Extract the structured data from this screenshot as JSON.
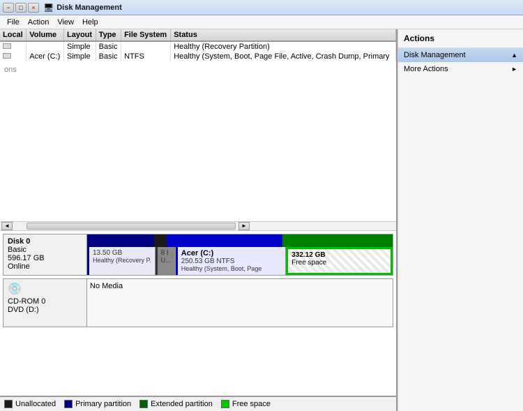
{
  "titleBar": {
    "title": "Disk Management",
    "closeLabel": "×",
    "minimizeLabel": "−",
    "maxrestoreLabel": "□"
  },
  "menuBar": {
    "items": [
      "File",
      "Action",
      "View",
      "Help"
    ]
  },
  "table": {
    "columns": [
      "Local",
      "Volume",
      "Layout",
      "Type",
      "File System",
      "Status"
    ],
    "rows": [
      {
        "local": "",
        "volume": "",
        "layout": "Simple",
        "type": "Basic",
        "fileSystem": "",
        "status": "Healthy (Recovery Partition)"
      },
      {
        "local": "",
        "volume": "Acer (C:)",
        "layout": "Simple",
        "type": "Basic",
        "fileSystem": "NTFS",
        "status": "Healthy (System, Boot, Page File, Active, Crash Dump, Primary"
      }
    ]
  },
  "diskDiagram": {
    "disks": [
      {
        "name": "Disk 0",
        "type": "Basic",
        "size": "596.17 GB",
        "status": "Online",
        "partitions": [
          {
            "label": "",
            "size": "13.50 GB",
            "status": "Healthy (Recovery P.",
            "type": "primary",
            "widthPct": 22
          },
          {
            "label": "",
            "size": "8 I",
            "status": "U...",
            "type": "black",
            "widthPct": 4
          },
          {
            "label": "Acer (C:)",
            "size": "250.53 GB NTFS",
            "status": "Healthy (System, Boot, Page",
            "type": "primary",
            "widthPct": 38
          },
          {
            "label": "332.12 GB",
            "subLabel": "Free space",
            "type": "freespace",
            "widthPct": 36
          }
        ]
      }
    ],
    "cdrom": {
      "name": "CD-ROM 0",
      "driveType": "DVD (D:)",
      "status": "No Media"
    }
  },
  "legend": [
    {
      "label": "Unallocated",
      "color": "#1a1a1a"
    },
    {
      "label": "Primary partition",
      "color": "#000080"
    },
    {
      "label": "Extended partition",
      "color": "#006400"
    },
    {
      "label": "Free space",
      "color": "#00c800"
    }
  ],
  "actions": {
    "header": "Actions",
    "items": [
      {
        "label": "Disk Management",
        "hasArrow": true,
        "selected": true
      },
      {
        "label": "More Actions",
        "hasArrow": true,
        "selected": false
      }
    ]
  }
}
